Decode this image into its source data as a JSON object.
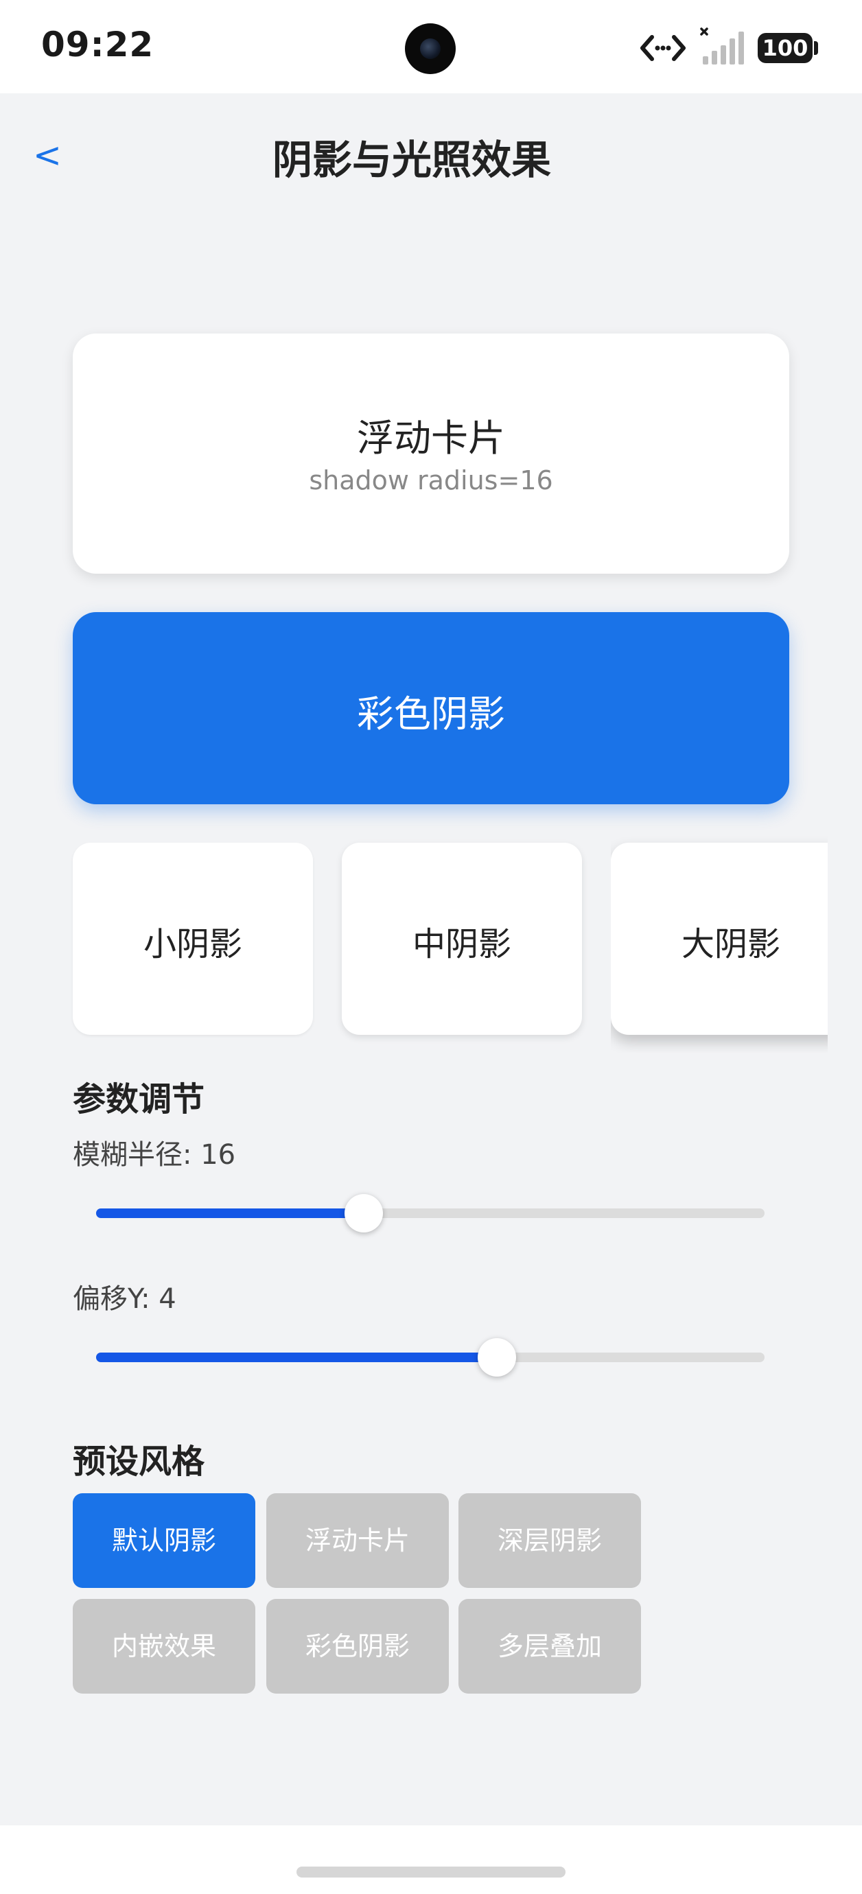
{
  "status_bar": {
    "time": "09:22",
    "battery": "100"
  },
  "header": {
    "back_label": "<",
    "title": "阴影与光照效果"
  },
  "float_card": {
    "title": "浮动卡片",
    "subtitle": "shadow radius=16"
  },
  "color_card": {
    "title": "彩色阴影"
  },
  "size_cards": [
    {
      "label": "小阴影"
    },
    {
      "label": "中阴影"
    },
    {
      "label": "大阴影"
    }
  ],
  "params": {
    "section_title": "参数调节",
    "blur": {
      "label": "模糊半径: 16",
      "level_percent": 40
    },
    "offset": {
      "label": "偏移Y: 4",
      "level_percent": 60
    }
  },
  "presets": {
    "section_title": "预设风格",
    "items": [
      {
        "label": "默认阴影",
        "active": true
      },
      {
        "label": "浮动卡片",
        "active": false
      },
      {
        "label": "深层阴影",
        "active": false
      },
      {
        "label": "内嵌效果",
        "active": false
      },
      {
        "label": "彩色阴影",
        "active": false
      },
      {
        "label": "多层叠加",
        "active": false
      }
    ]
  },
  "colors": {
    "accent": "#1a73e8",
    "slider_fill": "#1557e6",
    "preset_inactive": "#c8c8c8"
  }
}
